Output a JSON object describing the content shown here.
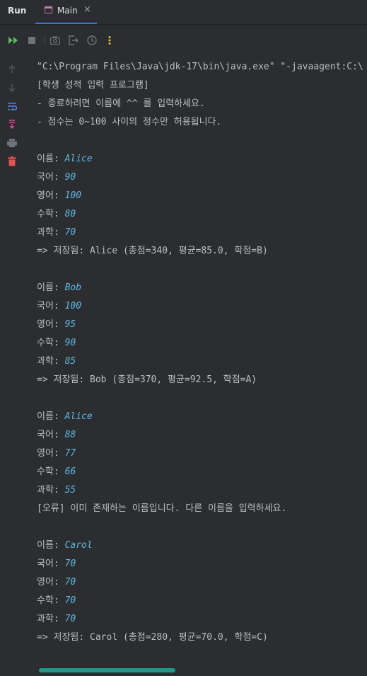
{
  "header": {
    "run_label": "Run",
    "tab_label": "Main",
    "tab_close": "×"
  },
  "toolbar": {
    "icons": [
      "rerun-icon",
      "stop-icon",
      "screenshot-icon",
      "exit-icon",
      "settings-icon",
      "more-icon"
    ]
  },
  "gutter": {
    "icons": [
      "up-arrow-icon",
      "down-arrow-icon",
      "soft-wrap-icon",
      "scroll-to-end-icon",
      "print-icon",
      "trash-icon"
    ]
  },
  "colors": {
    "background": "#2b2d30",
    "text": "#bcbec4",
    "input": "#5fb7e0",
    "accent_run": "#5fb865",
    "trash": "#e05555",
    "scrollbar": "#1e9a8a"
  },
  "console": {
    "lines": [
      {
        "text": "\"C:\\Program Files\\Java\\jdk-17\\bin\\java.exe\" \"-javaagent:C:\\"
      },
      {
        "text": "[학생 성적 입력 프로그램]"
      },
      {
        "text": "- 종료하려면 이름에 ^^ 를 입력하세요."
      },
      {
        "text": "- 점수는 0~100 사이의 정수만 허용됩니다."
      },
      {
        "text": ""
      },
      {
        "text": "이름: ",
        "input": "Alice"
      },
      {
        "text": "국어: ",
        "input": "90"
      },
      {
        "text": "영어: ",
        "input": "100"
      },
      {
        "text": "수학: ",
        "input": "80"
      },
      {
        "text": "과학: ",
        "input": "70"
      },
      {
        "text": "=> 저장됨: Alice (총점=340, 평균=85.0, 학점=B)"
      },
      {
        "text": ""
      },
      {
        "text": "이름: ",
        "input": "Bob"
      },
      {
        "text": "국어: ",
        "input": "100"
      },
      {
        "text": "영어: ",
        "input": "95"
      },
      {
        "text": "수학: ",
        "input": "90"
      },
      {
        "text": "과학: ",
        "input": "85"
      },
      {
        "text": "=> 저장됨: Bob (총점=370, 평균=92.5, 학점=A)"
      },
      {
        "text": ""
      },
      {
        "text": "이름: ",
        "input": "Alice"
      },
      {
        "text": "국어: ",
        "input": "88"
      },
      {
        "text": "영어: ",
        "input": "77"
      },
      {
        "text": "수학: ",
        "input": "66"
      },
      {
        "text": "과학: ",
        "input": "55"
      },
      {
        "text": "[오류] 이미 존재하는 이름입니다. 다른 이름을 입력하세요."
      },
      {
        "text": ""
      },
      {
        "text": "이름: ",
        "input": "Carol"
      },
      {
        "text": "국어: ",
        "input": "70"
      },
      {
        "text": "영어: ",
        "input": "70"
      },
      {
        "text": "수학: ",
        "input": "70"
      },
      {
        "text": "과학: ",
        "input": "70"
      },
      {
        "text": "=> 저장됨: Carol (총점=280, 평균=70.0, 학점=C)"
      }
    ]
  }
}
